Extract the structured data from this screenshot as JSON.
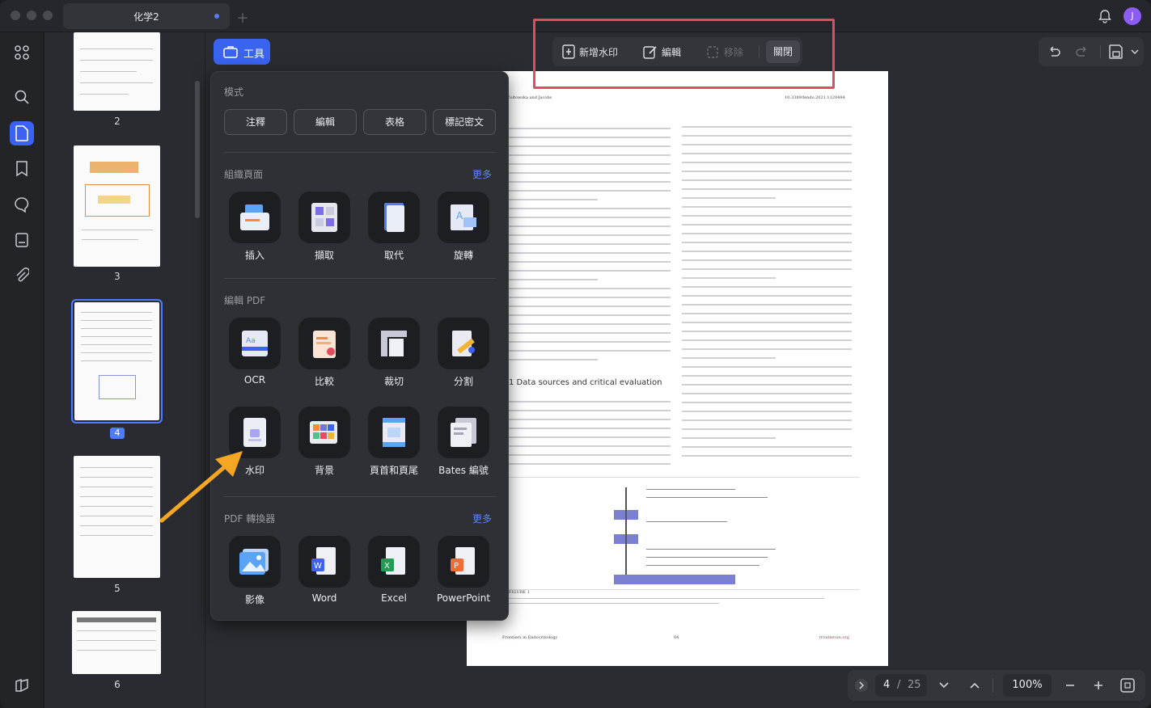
{
  "window": {
    "tab_title": "化学2",
    "avatar_letter": "J"
  },
  "toolbar": {
    "tool_label": "工具"
  },
  "watermark_bar": {
    "add": "新增水印",
    "edit": "編輯",
    "remove": "移除",
    "close": "關閉"
  },
  "thumbnails": [
    {
      "page": "2"
    },
    {
      "page": "3"
    },
    {
      "page": "4",
      "selected": true
    },
    {
      "page": "5"
    },
    {
      "page": "6"
    }
  ],
  "panel": {
    "mode_title": "模式",
    "modes": [
      "注釋",
      "編輯",
      "表格",
      "標記密文"
    ],
    "organize_title": "組織頁面",
    "organize_more": "更多",
    "organize": [
      "插入",
      "擷取",
      "取代",
      "旋轉"
    ],
    "edit_title": "編輯 PDF",
    "edit_row1": [
      "OCR",
      "比較",
      "裁切",
      "分割"
    ],
    "edit_row2": [
      "水印",
      "背景",
      "頁首和頁尾",
      "Bates 編號"
    ],
    "convert_title": "PDF 轉換器",
    "convert_more": "更多",
    "convert": [
      "影像",
      "Word",
      "Excel",
      "PowerPoint"
    ]
  },
  "document": {
    "header_left": "Zoltowska and Jacobs",
    "header_right": "10.3389/fendo.2021.1120484",
    "section_heading": "1 Data sources and critical evaluation",
    "footer_left": "Frontiers in Endocrinology",
    "footer_center": "04",
    "footer_right": "frontiersin.org",
    "figure_caption": "FIGURE 1"
  },
  "pager": {
    "current": "4",
    "separator": "/",
    "total": "25",
    "zoom": "100%"
  }
}
